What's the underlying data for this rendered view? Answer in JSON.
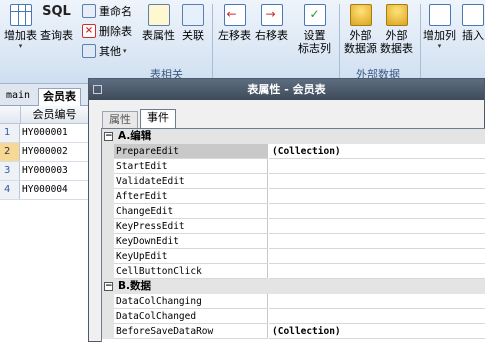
{
  "ribbon": {
    "buttons": {
      "add_table": "增加表",
      "query_table": "查询表",
      "sql": "SQL",
      "rename": "重命名",
      "delete_table": "删除表",
      "other": "其他",
      "table_properties": "表属性",
      "relations": "关联",
      "move_left": "左移表",
      "move_right": "右移表",
      "set_label_column": [
        "设置",
        "标志列"
      ],
      "external_datasource": [
        "外部",
        "数据源"
      ],
      "external_table": [
        "外部",
        "数据表"
      ],
      "add_column": "增加列",
      "insert": "插入"
    },
    "groups": {
      "table_related": "表相关",
      "external_data": "外部数据"
    }
  },
  "sheet": {
    "tabs": [
      "main",
      "会员表"
    ],
    "column_header": "会员编号",
    "rows": [
      {
        "n": "1",
        "value": "HY000001"
      },
      {
        "n": "2",
        "value": "HY000002"
      },
      {
        "n": "3",
        "value": "HY000003"
      },
      {
        "n": "4",
        "value": "HY000004"
      }
    ]
  },
  "dialog": {
    "title": "表属性 - 会员表",
    "tabs": [
      "属性",
      "事件"
    ],
    "active_tab": "事件",
    "categories": [
      {
        "toggle": "⊟",
        "label": "A.编辑",
        "props": [
          {
            "name": "PrepareEdit",
            "value": "(Collection)"
          },
          {
            "name": "StartEdit",
            "value": ""
          },
          {
            "name": "ValidateEdit",
            "value": ""
          },
          {
            "name": "AfterEdit",
            "value": ""
          },
          {
            "name": "ChangeEdit",
            "value": ""
          },
          {
            "name": "KeyPressEdit",
            "value": ""
          },
          {
            "name": "KeyDownEdit",
            "value": ""
          },
          {
            "name": "KeyUpEdit",
            "value": ""
          },
          {
            "name": "CellButtonClick",
            "value": ""
          }
        ]
      },
      {
        "toggle": "⊟",
        "label": "B.数据",
        "props": [
          {
            "name": "DataColChanging",
            "value": ""
          },
          {
            "name": "DataColChanged",
            "value": ""
          },
          {
            "name": "BeforeSaveDataRow",
            "value": "(Collection)"
          }
        ]
      }
    ]
  }
}
